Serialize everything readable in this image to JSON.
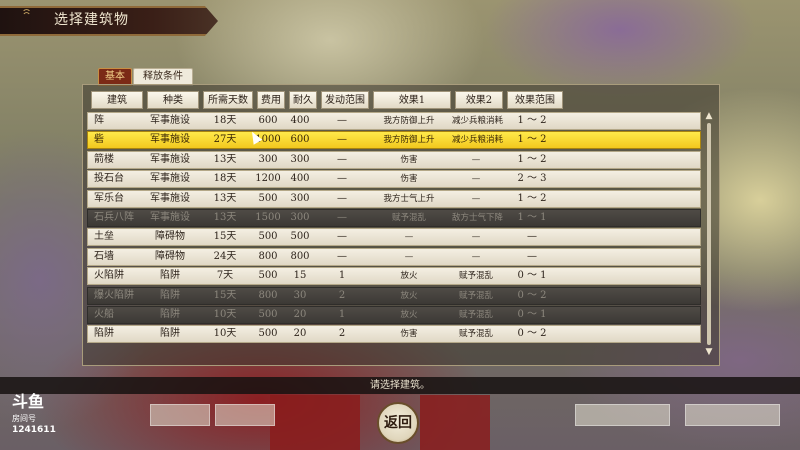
{
  "title": "选择建筑物",
  "tabs": [
    {
      "label": "基本",
      "active": true
    },
    {
      "label": "释放条件",
      "active": false
    }
  ],
  "columns": [
    "建筑",
    "种类",
    "所需天数",
    "费用",
    "耐久",
    "发动范围",
    "效果1",
    "效果2",
    "效果范围"
  ],
  "rows": [
    {
      "name": "阵",
      "type": "军事施设",
      "days": "18天",
      "cost": "600",
      "dur": "400",
      "range": "—",
      "eff1": "我方防御上升",
      "eff2": "减少兵粮消耗",
      "erange": "1 ～ 2",
      "state": "normal"
    },
    {
      "name": "砦",
      "type": "军事施设",
      "days": "27天",
      "cost": "1000",
      "dur": "600",
      "range": "—",
      "eff1": "我方防御上升",
      "eff2": "减少兵粮消耗",
      "erange": "1 ～ 2",
      "state": "selected"
    },
    {
      "name": "箭楼",
      "type": "军事施设",
      "days": "13天",
      "cost": "300",
      "dur": "300",
      "range": "—",
      "eff1": "伤害",
      "eff2": "—",
      "erange": "1 ～ 2",
      "state": "normal"
    },
    {
      "name": "投石台",
      "type": "军事施设",
      "days": "18天",
      "cost": "1200",
      "dur": "400",
      "range": "—",
      "eff1": "伤害",
      "eff2": "—",
      "erange": "2 ～ 3",
      "state": "normal"
    },
    {
      "name": "军乐台",
      "type": "军事施设",
      "days": "13天",
      "cost": "500",
      "dur": "300",
      "range": "—",
      "eff1": "我方士气上升",
      "eff2": "—",
      "erange": "1 ～ 2",
      "state": "normal"
    },
    {
      "name": "石兵八阵",
      "type": "军事施设",
      "days": "13天",
      "cost": "1500",
      "dur": "300",
      "range": "—",
      "eff1": "赋予混乱",
      "eff2": "敌方士气下降",
      "erange": "1 ～ 1",
      "state": "disabled"
    },
    {
      "name": "土垒",
      "type": "障碍物",
      "days": "15天",
      "cost": "500",
      "dur": "500",
      "range": "—",
      "eff1": "—",
      "eff2": "—",
      "erange": "—",
      "state": "normal"
    },
    {
      "name": "石墙",
      "type": "障碍物",
      "days": "24天",
      "cost": "800",
      "dur": "800",
      "range": "—",
      "eff1": "—",
      "eff2": "—",
      "erange": "—",
      "state": "normal"
    },
    {
      "name": "火陷阱",
      "type": "陷阱",
      "days": "7天",
      "cost": "500",
      "dur": "15",
      "range": "1",
      "eff1": "放火",
      "eff2": "赋予混乱",
      "erange": "0 ～ 1",
      "state": "normal"
    },
    {
      "name": "爆火陷阱",
      "type": "陷阱",
      "days": "15天",
      "cost": "800",
      "dur": "30",
      "range": "2",
      "eff1": "放火",
      "eff2": "赋予混乱",
      "erange": "0 ～ 2",
      "state": "disabled"
    },
    {
      "name": "火船",
      "type": "陷阱",
      "days": "10天",
      "cost": "500",
      "dur": "20",
      "range": "1",
      "eff1": "放火",
      "eff2": "赋予混乱",
      "erange": "0 ～ 1",
      "state": "disabled"
    },
    {
      "name": "陷阱",
      "type": "陷阱",
      "days": "10天",
      "cost": "500",
      "dur": "20",
      "range": "2",
      "eff1": "伤害",
      "eff2": "赋予混乱",
      "erange": "0 ～ 2",
      "state": "normal"
    }
  ],
  "status_text": "请选择建筑。",
  "back_label": "返回",
  "watermark": {
    "logo": "斗鱼",
    "sub": "房间号",
    "room_id": "1241611"
  },
  "colors": {
    "selected_row": "#f2c81e",
    "active_tab": "#7b2a16",
    "disabled_row": "#3c3935"
  }
}
